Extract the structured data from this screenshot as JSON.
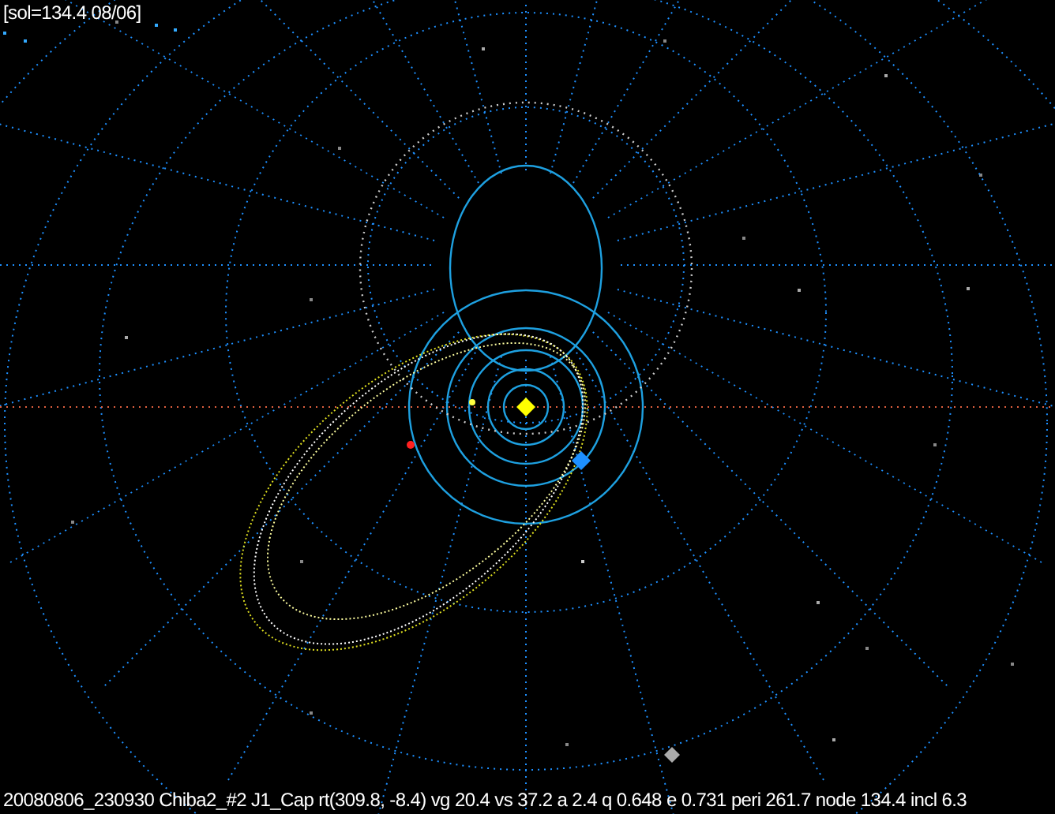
{
  "header": {
    "text": "[sol=134.4 08/06]"
  },
  "footer": {
    "text": "20080806_230930 Chiba2_#2 J1_Cap rt(309.8, -8.4) vg 20.4 vs 37.2 a 2.4 q 0.648 e 0.731 peri 261.7 node 134.4 incl 6.3"
  }
}
